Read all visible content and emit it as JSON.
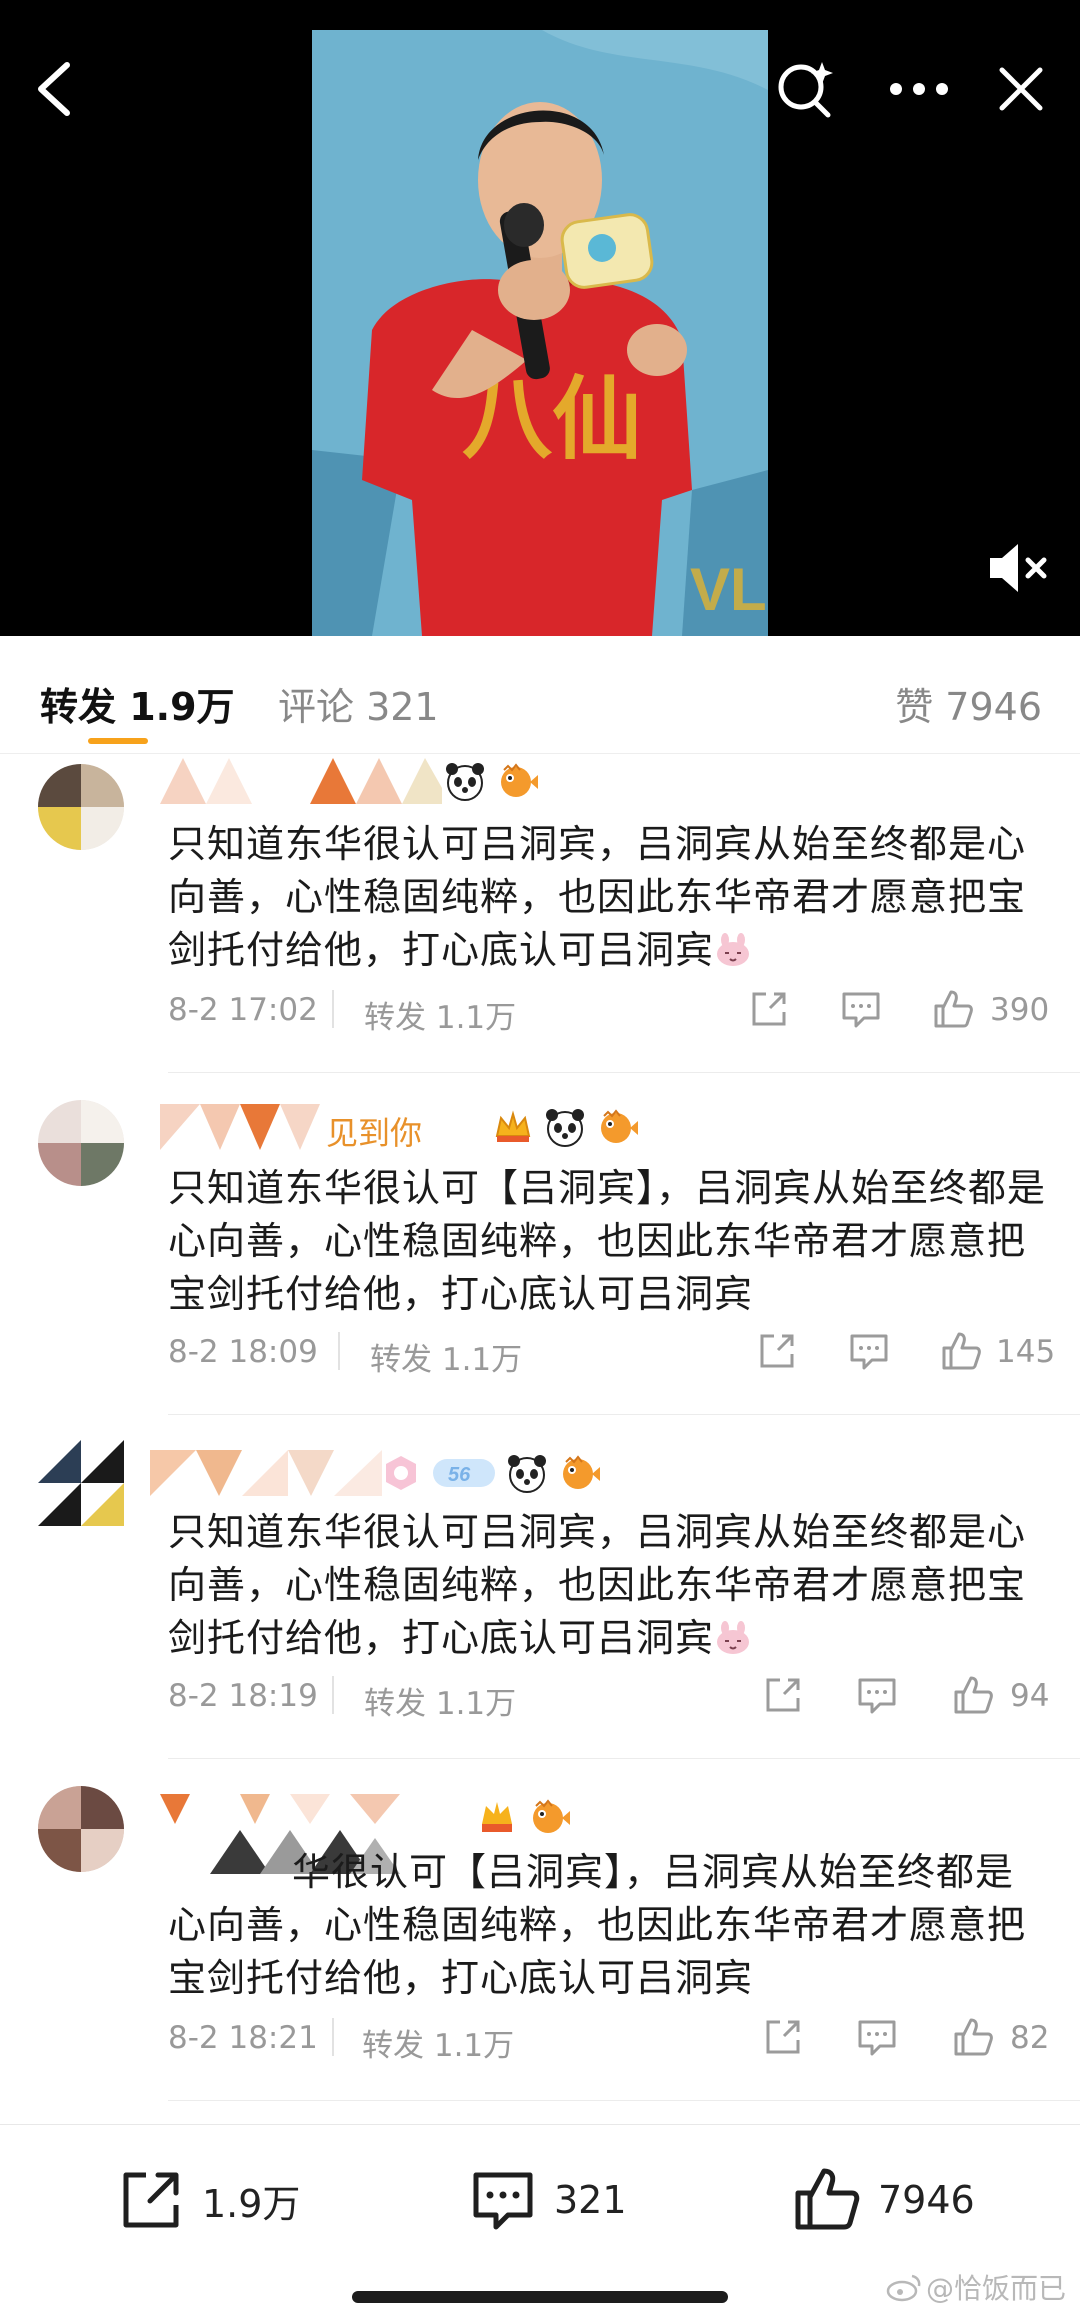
{
  "header": {
    "back_icon": "chevron-left-icon",
    "search_icon": "magic-search-icon",
    "more_icon": "more-dots-icon",
    "close_icon": "close-icon",
    "mute_icon": "speaker-muted-icon"
  },
  "stats": {
    "repost": "转发 1.9万",
    "comments": "评论 321",
    "likes": "赞 7946"
  },
  "comments": [
    {
      "name_visible": "",
      "text": "只知道东华很认可吕洞宾，吕洞宾从始至终都是心向善，心性稳固纯粹，也因此东华帝君才愿意把宝剑托付给他，打心底认可吕洞宾",
      "date": "8-2 17:02",
      "repost": "转发 1.1万",
      "likes": "390"
    },
    {
      "name_visible": "见到你",
      "text": "只知道东华很认可【吕洞宾】，吕洞宾从始至终都是心向善，心性稳固纯粹，也因此东华帝君才愿意把宝剑托付给他，打心底认可吕洞宾",
      "date": "8-2 18:09",
      "repost": "转发 1.1万",
      "likes": "145"
    },
    {
      "name_visible": "",
      "text": "只知道东华很认可吕洞宾，吕洞宾从始至终都是心向善，心性稳固纯粹，也因此东华帝君才愿意把宝剑托付给他，打心底认可吕洞宾",
      "date": "8-2 18:19",
      "repost": "转发 1.1万",
      "likes": "94"
    },
    {
      "name_visible": "",
      "text": "华很认可【吕洞宾】，吕洞宾从始至终都是心向善，心性稳固纯粹，也因此东华帝君才愿意把宝剑托付给他，打心底认可吕洞宾",
      "date": "8-2 18:21",
      "repost": "转发 1.1万",
      "likes": "82"
    }
  ],
  "bottom_bar": {
    "repost": "1.9万",
    "comments": "321",
    "likes": "7946"
  },
  "watermark": "@恰饭而已",
  "colors": {
    "accent": "#f7a21b",
    "username": "#e8912a",
    "muted_text": "#999999"
  }
}
